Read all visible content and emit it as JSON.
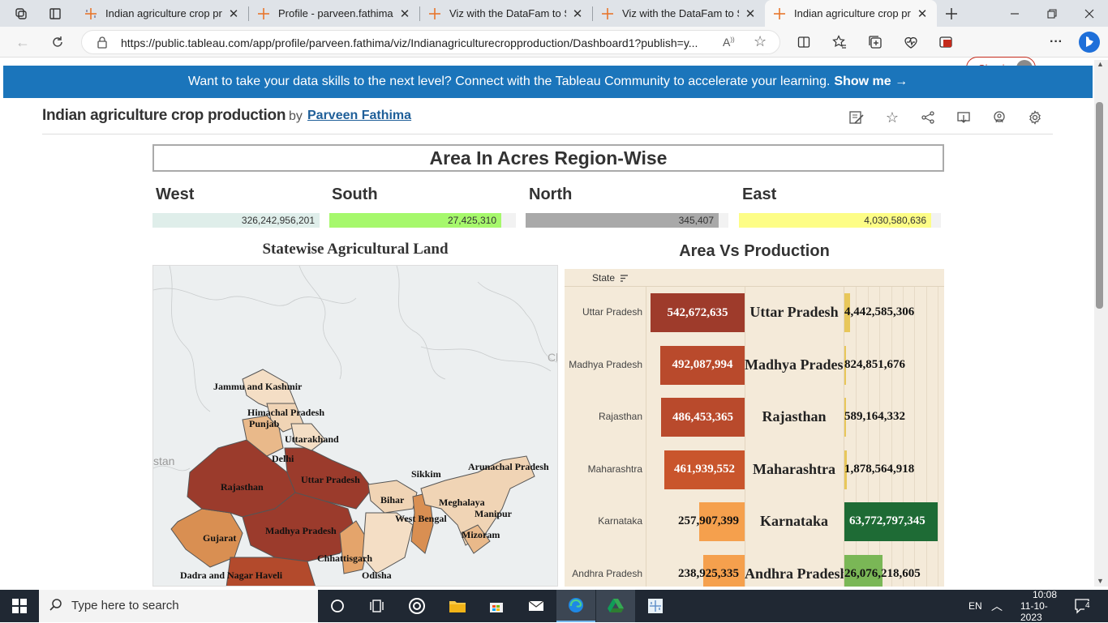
{
  "browser": {
    "tabs": [
      {
        "title": "Indian agriculture crop prod",
        "active": false
      },
      {
        "title": "Profile - parveen.fathima | Ta",
        "active": false
      },
      {
        "title": "Viz with the DataFam to Sha",
        "active": false
      },
      {
        "title": "Viz with the DataFam to Sha",
        "active": false
      },
      {
        "title": "Indian agriculture crop proc",
        "active": true
      }
    ],
    "url": "https://public.tableau.com/app/profile/parveen.fathima/viz/Indianagriculturecropproduction/Dashboard1?publish=y...",
    "signin_label": "Sign in"
  },
  "banner": {
    "text": "Want to take your data skills to the next level? Connect with the Tableau Community to accelerate your learning.",
    "link": "Show me →"
  },
  "viz": {
    "title": "Indian agriculture crop production",
    "by": "by",
    "author": "Parveen Fathima"
  },
  "dashboard": {
    "title": "Area In Acres Region-Wise",
    "regions": [
      {
        "name": "West",
        "value": "326,242,956,201",
        "fill": 1.0,
        "color": "#dfeeea"
      },
      {
        "name": "South",
        "value": "27,425,310",
        "fill": 1.0,
        "color": "#a6f86c"
      },
      {
        "name": "North",
        "value": "345,407",
        "fill": 1.0,
        "color": "#a9a9a9"
      },
      {
        "name": "East",
        "value": "4,030,580,636",
        "fill": 1.0,
        "color": "#fdfd86"
      }
    ],
    "map_title": "Statewise Agricultural Land",
    "map_labels": [
      "Jammu and Kashmir",
      "Himachal Pradesh",
      "Punjab",
      "Uttarakhand",
      "Delhi",
      "Rajasthan",
      "Uttar Pradesh",
      "Sikkim",
      "Arunachal Pradesh",
      "Bihar",
      "Meghalaya",
      "Manipur",
      "West Bengal",
      "Mizoram",
      "Gujarat",
      "Madhya Pradesh",
      "Chhattisgarh",
      "Odisha",
      "Dadra and Nagar Haveli"
    ],
    "map_bg_labels": [
      "Cl",
      "stan"
    ],
    "table_title": "Area Vs Production",
    "table_header": "State",
    "rows": [
      {
        "state": "Uttar Pradesh",
        "area": "542,672,635",
        "area_frac": 1.0,
        "area_color": "#9e3b2b",
        "production": "4,442,585,306",
        "prod_frac": 0.06,
        "prod_color": "#e8c75a"
      },
      {
        "state": "Madhya Pradesh",
        "area": "492,087,994",
        "area_frac": 0.9,
        "area_color": "#b94a2c",
        "production": "824,851,676",
        "prod_frac": 0.012,
        "prod_color": "#e8c75a"
      },
      {
        "state": "Rajasthan",
        "area": "486,453,365",
        "area_frac": 0.89,
        "area_color": "#b94a2c",
        "production": "589,164,332",
        "prod_frac": 0.008,
        "prod_color": "#e8c75a"
      },
      {
        "state": "Maharashtra",
        "area": "461,939,552",
        "area_frac": 0.85,
        "area_color": "#c9552c",
        "production": "1,878,564,918",
        "prod_frac": 0.025,
        "prod_color": "#e8c75a"
      },
      {
        "state": "Karnataka",
        "area": "257,907,399",
        "area_frac": 0.48,
        "area_color": "#f5a04d",
        "production": "63,772,797,345",
        "prod_frac": 1.0,
        "prod_color": "#1e6b35"
      },
      {
        "state": "Andhra Pradesh",
        "area": "238,925,335",
        "area_frac": 0.44,
        "area_color": "#f5a04d",
        "production": "26,076,218,605",
        "prod_frac": 0.41,
        "prod_color": "#7ab756"
      }
    ]
  },
  "taskbar": {
    "search_placeholder": "Type here to search",
    "lang": "EN",
    "time": "10:08",
    "date": "11-10-2023",
    "notifications": "4"
  }
}
